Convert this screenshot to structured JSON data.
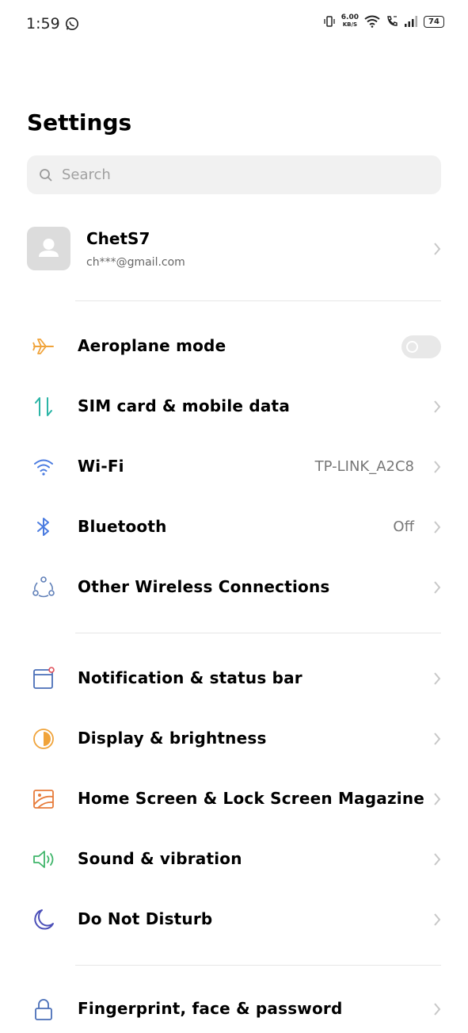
{
  "status_bar": {
    "time": "1:59",
    "net_speed_value": "6.00",
    "net_speed_unit": "KB/S",
    "battery": "74",
    "icons": [
      "whatsapp-icon",
      "vibrate-icon",
      "wifi-icon",
      "volte-call-icon",
      "signal-icon",
      "battery-icon"
    ]
  },
  "page": {
    "title": "Settings"
  },
  "search": {
    "placeholder": "Search"
  },
  "account": {
    "name": "ChetS7",
    "email": "ch***@gmail.com"
  },
  "items": [
    {
      "label": "Aeroplane mode",
      "value": "",
      "control": "toggle",
      "toggle_on": false,
      "icon": "aeroplane-icon",
      "color": "#f0a33a"
    },
    {
      "label": "SIM card & mobile data",
      "value": "",
      "control": "chevron",
      "icon": "sim-data-icon",
      "color": "#2bb5a6"
    },
    {
      "label": "Wi-Fi",
      "value": "TP-LINK_A2C8",
      "control": "chevron",
      "icon": "wifi-icon",
      "color": "#4a7be0"
    },
    {
      "label": "Bluetooth",
      "value": "Off",
      "control": "chevron",
      "icon": "bluetooth-icon",
      "color": "#4a7be0"
    },
    {
      "label": "Other Wireless Connections",
      "value": "",
      "control": "chevron",
      "icon": "connections-icon",
      "color": "#5f7fb8"
    },
    {
      "label": "Notification & status bar",
      "value": "",
      "control": "chevron",
      "icon": "notification-icon",
      "color": "#4a6fb8"
    },
    {
      "label": "Display & brightness",
      "value": "",
      "control": "chevron",
      "icon": "brightness-icon",
      "color": "#f0a33a"
    },
    {
      "label": "Home Screen & Lock Screen Magazine",
      "value": "",
      "control": "chevron",
      "icon": "wallpaper-icon",
      "color": "#e77b3a"
    },
    {
      "label": "Sound & vibration",
      "value": "",
      "control": "chevron",
      "icon": "sound-icon",
      "color": "#3fb56a"
    },
    {
      "label": "Do Not Disturb",
      "value": "",
      "control": "chevron",
      "icon": "moon-icon",
      "color": "#4b4fb8"
    },
    {
      "label": "Fingerprint, face & password",
      "value": "",
      "control": "chevron",
      "icon": "lock-icon",
      "color": "#4a6fb8"
    }
  ]
}
